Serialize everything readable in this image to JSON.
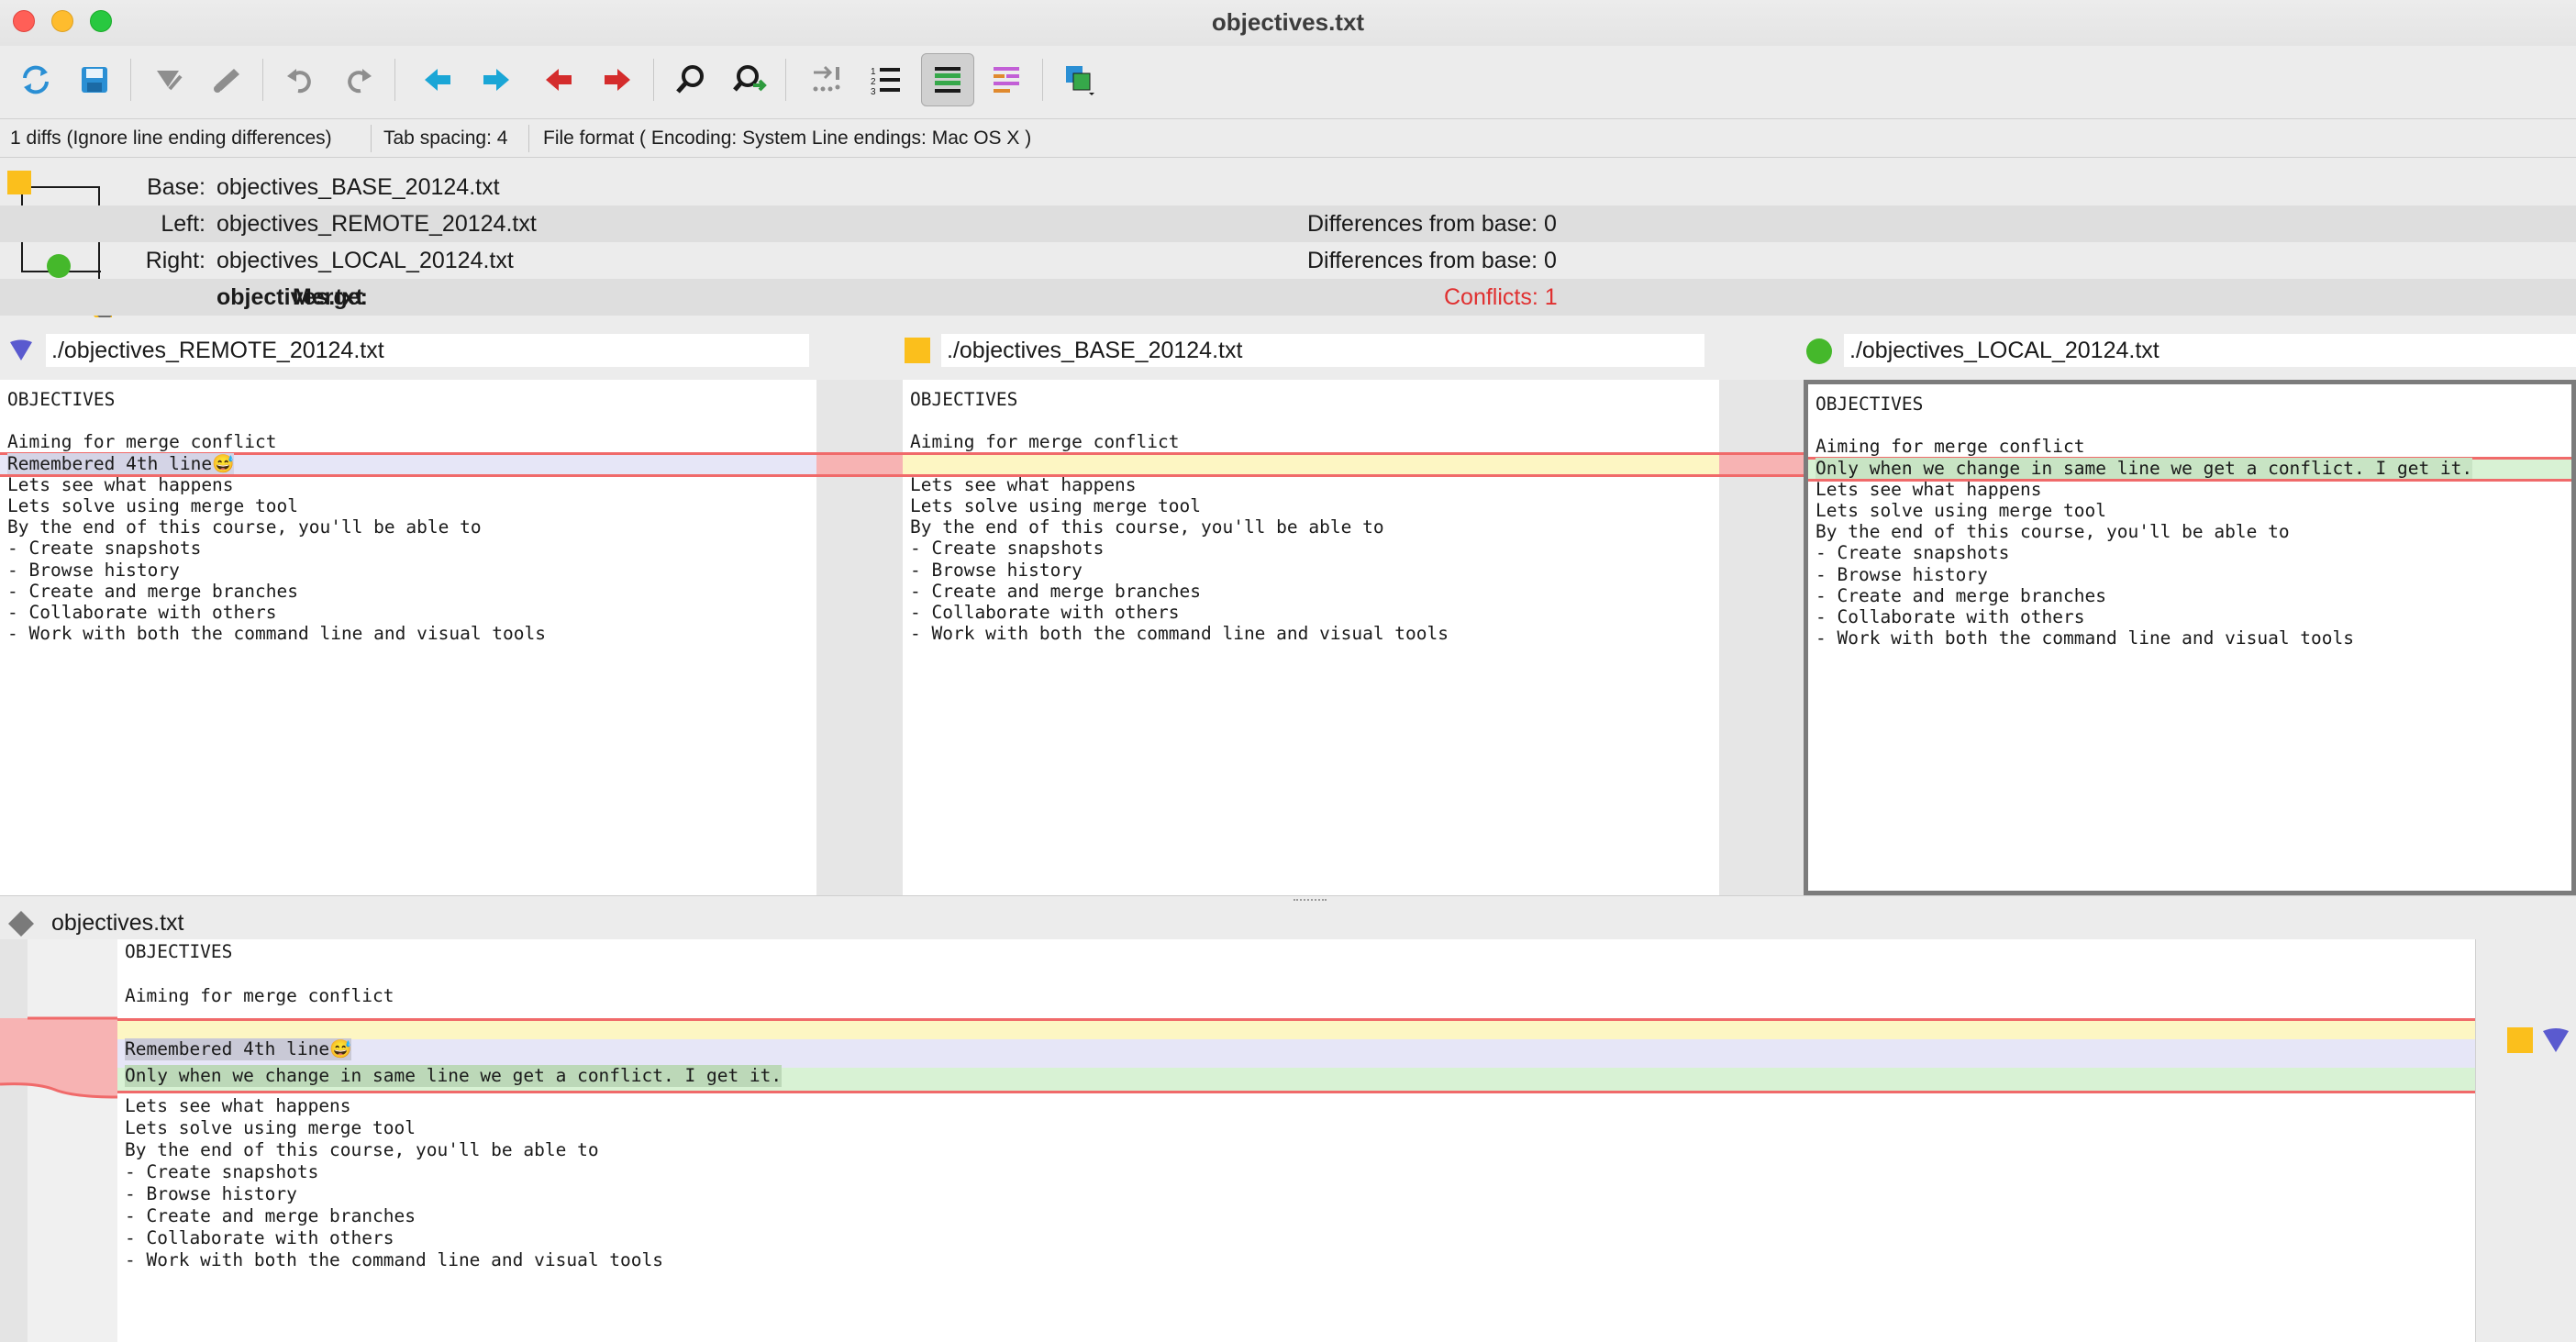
{
  "window": {
    "title": "objectives.txt"
  },
  "toolbar": {
    "buttons": [
      {
        "name": "reload-icon",
        "tip": "Reload"
      },
      {
        "name": "save-icon",
        "tip": "Save"
      },
      {
        "name": "mark-resolved-icon",
        "tip": "Mark resolved"
      },
      {
        "name": "mark-unresolved-icon",
        "tip": "Mark unresolved"
      },
      {
        "name": "undo-icon",
        "tip": "Undo"
      },
      {
        "name": "redo-icon",
        "tip": "Redo"
      },
      {
        "name": "prev-diff-icon",
        "tip": "Previous difference"
      },
      {
        "name": "next-diff-icon",
        "tip": "Next difference"
      },
      {
        "name": "prev-conflict-icon",
        "tip": "Previous conflict"
      },
      {
        "name": "next-conflict-icon",
        "tip": "Next conflict"
      },
      {
        "name": "find-icon",
        "tip": "Find"
      },
      {
        "name": "find-next-icon",
        "tip": "Find next"
      },
      {
        "name": "show-whitespace-icon",
        "tip": "Show whitespace"
      },
      {
        "name": "line-numbers-icon",
        "tip": "Line numbers"
      },
      {
        "name": "highlight-diffs-icon",
        "tip": "Highlight differences"
      },
      {
        "name": "highlight-changes-icon",
        "tip": "Highlight changes"
      },
      {
        "name": "layout-icon",
        "tip": "Layout"
      }
    ]
  },
  "status": {
    "diffs": "1 diffs (Ignore line ending differences)",
    "tab_spacing": "Tab spacing: 4",
    "file_format": "File format ( Encoding: System  Line endings: Mac OS X )"
  },
  "files": {
    "base_label": "Base:",
    "base_value": "objectives_BASE_20124.txt",
    "left_label": "Left:",
    "left_value": "objectives_REMOTE_20124.txt",
    "left_diff": "Differences from base: 0",
    "right_label": "Right:",
    "right_value": "objectives_LOCAL_20124.txt",
    "right_diff": "Differences from base: 0",
    "merge_label": "Merge:",
    "merge_value": "objectives.txt",
    "merge_conflicts": "Conflicts: 1"
  },
  "panes": {
    "remote_path": "./objectives_REMOTE_20124.txt",
    "base_path": "./objectives_BASE_20124.txt",
    "local_path": "./objectives_LOCAL_20124.txt",
    "remote_lines": [
      "OBJECTIVES",
      "",
      "Aiming for merge conflict",
      "Remembered 4th line😅",
      "Lets see what happens",
      "Lets solve using merge tool",
      "By the end of this course, you'll be able to",
      "- Create snapshots",
      "- Browse history",
      "- Create and merge branches",
      "- Collaborate with others",
      "- Work with both the command line and visual tools"
    ],
    "base_lines": [
      "OBJECTIVES",
      "",
      "Aiming for merge conflict",
      "",
      "Lets see what happens",
      "Lets solve using merge tool",
      "By the end of this course, you'll be able to",
      "- Create snapshots",
      "- Browse history",
      "- Create and merge branches",
      "- Collaborate with others",
      "- Work with both the command line and visual tools"
    ],
    "local_lines": [
      "OBJECTIVES",
      "",
      "Aiming for merge conflict",
      "Only when we change in same line we get a conflict. I get it.",
      "Lets see what happens",
      "Lets solve using merge tool",
      "By the end of this course, you'll be able to",
      "- Create snapshots",
      "- Browse history",
      "- Create and merge branches",
      "- Collaborate with others",
      "- Work with both the command line and visual tools"
    ]
  },
  "merge": {
    "filename": "objectives.txt",
    "lines_top": [
      "OBJECTIVES",
      "",
      "Aiming for merge conflict"
    ],
    "conflict_remote": "Remembered 4th line😅",
    "conflict_local": "Only when we change in same line we get a conflict. I get it.",
    "lines_bottom": [
      "Lets see what happens",
      "Lets solve using merge tool",
      "By the end of this course, you'll be able to",
      "- Create snapshots",
      "- Browse history",
      "- Create and merge branches",
      "- Collaborate with others",
      "- Work with both the command line and visual tools"
    ]
  },
  "colors": {
    "conflict_line": "#f06a6a",
    "remote_bg": "#e6e6f7",
    "base_bg": "#fdf6c3",
    "local_bg": "#d8f2d4",
    "gutter_conflict": "#f7b3b3",
    "remote_marker": "#5a5acf",
    "base_marker": "#fbbf1c",
    "local_marker": "#45b82b"
  }
}
